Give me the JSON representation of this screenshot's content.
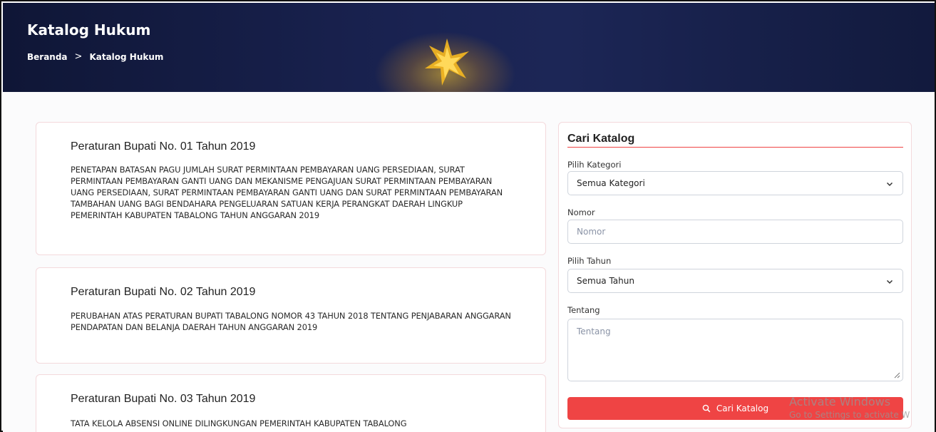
{
  "header": {
    "title": "Katalog Hukum",
    "breadcrumb": [
      {
        "label": "Beranda"
      },
      {
        "label": "Katalog Hukum"
      }
    ],
    "separator": ">"
  },
  "catalog": [
    {
      "title": "Peraturan Bupati No. 01 Tahun 2019",
      "description": "PENETAPAN BATASAN PAGU JUMLAH SURAT PERMINTAAN PEMBAYARAN UANG PERSEDIAAN, SURAT PERMINTAAN PEMBAYARAN GANTI UANG DAN MEKANISME PENGAJUAN SURAT PERMINTAAN PEMBAYARAN UANG PERSEDIAAN, SURAT PERMINTAAN PEMBAYARAN GANTI UANG DAN SURAT PERMINTAAN PEMBAYARAN TAMBAHAN UANG BAGI BENDAHARA PENGELUARAN SATUAN KERJA PERANGKAT DAERAH LINGKUP PEMERINTAH KABUPATEN TABALONG TAHUN ANGGARAN 2019"
    },
    {
      "title": "Peraturan Bupati No. 02 Tahun 2019",
      "description": "PERUBAHAN ATAS PERATURAN BUPATI TABALONG NOMOR 43 TAHUN 2018 TENTANG PENJABARAN ANGGARAN PENDAPATAN DAN BELANJA DAERAH TAHUN ANGGARAN 2019"
    },
    {
      "title": "Peraturan Bupati No. 03 Tahun 2019",
      "description": "TATA KELOLA ABSENSI ONLINE DILINGKUNGAN PEMERINTAH KABUPATEN TABALONG"
    }
  ],
  "search": {
    "title": "Cari Katalog",
    "category_label": "Pilih Kategori",
    "category_value": "Semua Kategori",
    "number_label": "Nomor",
    "number_placeholder": "Nomor",
    "year_label": "Pilih Tahun",
    "year_value": "Semua Tahun",
    "about_label": "Tentang",
    "about_placeholder": "Tentang",
    "button_label": "Cari Katalog"
  },
  "watermark": {
    "line1": "Activate Windows",
    "line2": "Go to Settings to activate W"
  },
  "colors": {
    "accent": "#ef4444",
    "header_bg": "#1a2352"
  }
}
